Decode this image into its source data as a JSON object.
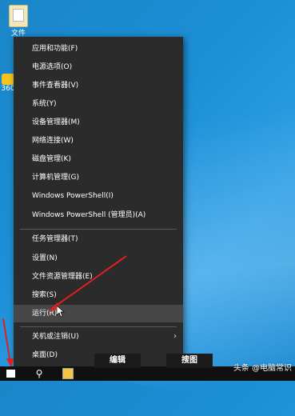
{
  "desktop": {
    "folder_label": "文件",
    "app_label": "360"
  },
  "menu": {
    "items": [
      {
        "label": "应用和功能(F)"
      },
      {
        "label": "电源选项(O)"
      },
      {
        "label": "事件查看器(V)"
      },
      {
        "label": "系统(Y)"
      },
      {
        "label": "设备管理器(M)"
      },
      {
        "label": "网络连接(W)"
      },
      {
        "label": "磁盘管理(K)"
      },
      {
        "label": "计算机管理(G)"
      },
      {
        "label": "Windows PowerShell(I)"
      },
      {
        "label": "Windows PowerShell (管理员)(A)"
      },
      {
        "label": "任务管理器(T)"
      },
      {
        "label": "设置(N)"
      },
      {
        "label": "文件资源管理器(E)"
      },
      {
        "label": "搜索(S)"
      },
      {
        "label": "运行(R)",
        "highlighted": true
      },
      {
        "label": "关机或注销(U)",
        "has_submenu": true
      },
      {
        "label": "桌面(D)"
      }
    ]
  },
  "overlay": {
    "edit_label": "编辑",
    "search_label": "搜图",
    "watermark": "头条 @电脑常识"
  },
  "colors": {
    "menu_bg": "#2b2b2b",
    "highlight": "#474747",
    "annotation_arrow": "#e02020"
  },
  "icons": [
    "folder-icon",
    "app-360-icon",
    "windows-start-icon",
    "search-icon",
    "chevron-right-icon",
    "mouse-cursor-icon"
  ]
}
